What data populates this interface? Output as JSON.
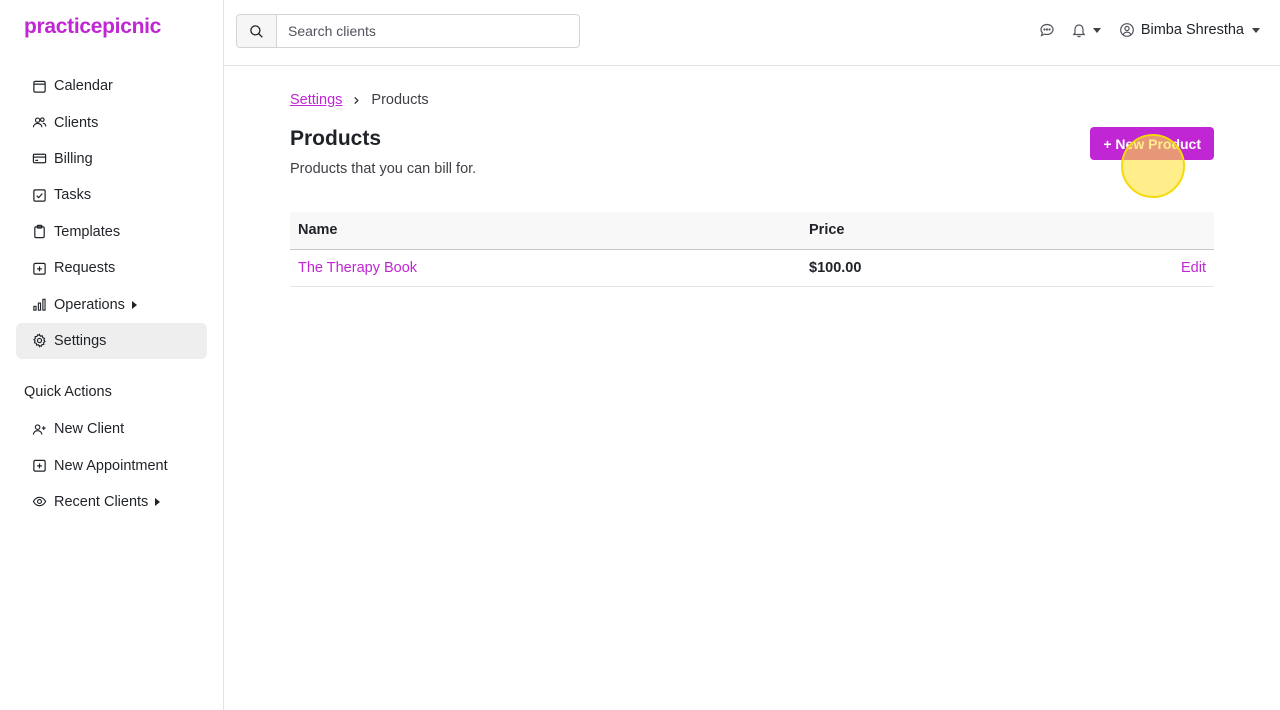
{
  "app": {
    "logo_text": "practicepicnic",
    "brand_color": "#c026d3"
  },
  "sidebar": {
    "items": [
      {
        "label": "Calendar",
        "icon": "calendar-icon"
      },
      {
        "label": "Clients",
        "icon": "users-icon"
      },
      {
        "label": "Billing",
        "icon": "credit-card-icon"
      },
      {
        "label": "Tasks",
        "icon": "checkbox-icon"
      },
      {
        "label": "Templates",
        "icon": "clipboard-icon"
      },
      {
        "label": "Requests",
        "icon": "plus-square-icon"
      },
      {
        "label": "Operations",
        "icon": "bar-chart-icon",
        "has_submenu": true
      },
      {
        "label": "Settings",
        "icon": "gear-icon",
        "active": true
      }
    ],
    "quick_actions_title": "Quick Actions",
    "quick_actions": [
      {
        "label": "New Client",
        "icon": "user-plus-icon"
      },
      {
        "label": "New Appointment",
        "icon": "calendar-plus-icon"
      },
      {
        "label": "Recent Clients",
        "icon": "eye-icon",
        "has_submenu": true
      }
    ]
  },
  "topbar": {
    "search_placeholder": "Search clients",
    "search_value": "",
    "user_name": "Bimba Shrestha",
    "icons": [
      "chat-icon",
      "bell-icon",
      "user-circle-icon"
    ]
  },
  "breadcrumb": {
    "parent": "Settings",
    "current": "Products"
  },
  "page": {
    "title": "Products",
    "subtitle": "Products that you can bill for.",
    "new_button": "+ New Product"
  },
  "table": {
    "columns": [
      "Name",
      "Price"
    ],
    "rows": [
      {
        "name": "The Therapy Book",
        "price": "$100.00",
        "action": "Edit"
      }
    ]
  }
}
